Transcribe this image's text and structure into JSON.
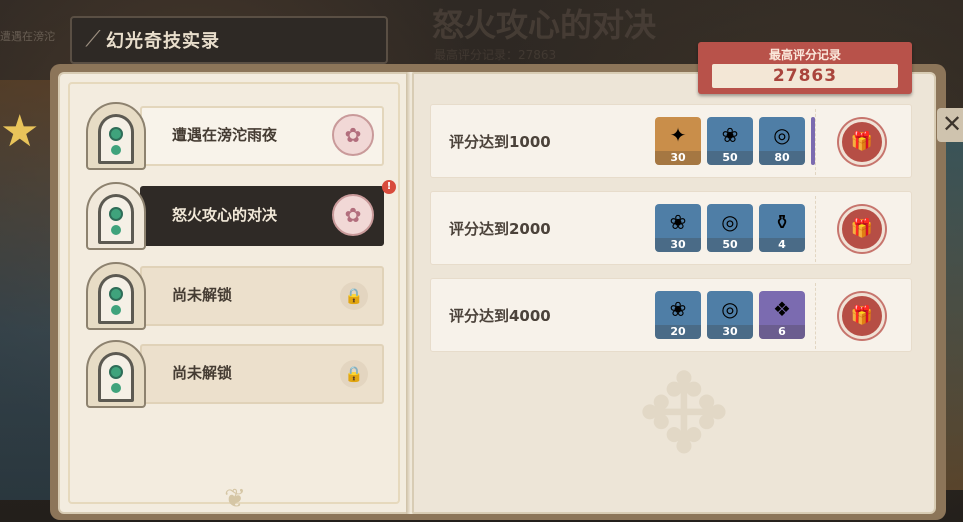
{
  "background": {
    "top_title": "怒火攻心的对决",
    "top_subtitle": "最高评分记录：27863",
    "top_left_text": "遭遇在滂沱"
  },
  "header": {
    "title": "幻光奇技实录"
  },
  "high_score": {
    "label": "最高评分记录",
    "value": "27863"
  },
  "stages": [
    {
      "name": "遭遇在滂沱雨夜",
      "state": "unlocked",
      "emblem_icon": "flower-emblem-icon"
    },
    {
      "name": "怒火攻心的对决",
      "state": "selected",
      "emblem_icon": "flower-emblem-icon",
      "notification": "!"
    },
    {
      "name": "尚未解锁",
      "state": "locked",
      "emblem_icon": "lock-icon"
    },
    {
      "name": "尚未解锁",
      "state": "locked",
      "emblem_icon": "lock-icon"
    }
  ],
  "rewards": [
    {
      "requirement": "评分达到1000",
      "items": [
        {
          "icon": "primogem-icon",
          "count": "30",
          "rarity": "orange"
        },
        {
          "icon": "flower-card-icon",
          "count": "50",
          "rarity": "blue"
        },
        {
          "icon": "film-reel-icon",
          "count": "80",
          "rarity": "blue"
        },
        {
          "icon": "partial-item-icon",
          "count": "",
          "rarity": "purple"
        }
      ]
    },
    {
      "requirement": "评分达到2000",
      "items": [
        {
          "icon": "flower-card-icon",
          "count": "30",
          "rarity": "blue"
        },
        {
          "icon": "film-reel-icon",
          "count": "50",
          "rarity": "blue"
        },
        {
          "icon": "potion-icon",
          "count": "4",
          "rarity": "blue"
        }
      ]
    },
    {
      "requirement": "评分达到4000",
      "items": [
        {
          "icon": "flower-card-icon",
          "count": "20",
          "rarity": "blue"
        },
        {
          "icon": "film-reel-icon",
          "count": "30",
          "rarity": "blue"
        },
        {
          "icon": "crystal-icon",
          "count": "6",
          "rarity": "purple"
        }
      ]
    }
  ],
  "close_label": "✕",
  "colors": {
    "accent_red": "#b8524a",
    "page_cream": "#f3ecdf",
    "selected_dark": "#2f2a26"
  }
}
